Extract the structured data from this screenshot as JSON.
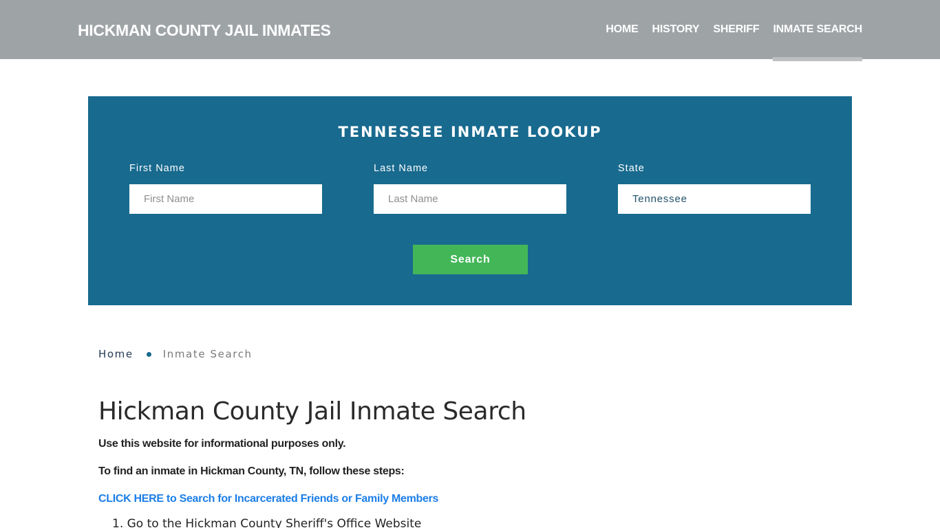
{
  "header": {
    "brand": "HICKMAN COUNTY JAIL INMATES",
    "nav": [
      {
        "label": "HOME",
        "active": false
      },
      {
        "label": "HISTORY",
        "active": false
      },
      {
        "label": "SHERIFF",
        "active": false
      },
      {
        "label": "INMATE SEARCH",
        "active": true
      }
    ]
  },
  "lookup": {
    "title": "TENNESSEE INMATE LOOKUP",
    "first_name": {
      "label": "First Name",
      "placeholder": "First Name",
      "value": ""
    },
    "last_name": {
      "label": "Last Name",
      "placeholder": "Last Name",
      "value": ""
    },
    "state": {
      "label": "State",
      "value": "Tennessee"
    },
    "search_label": "Search"
  },
  "breadcrumb": {
    "home": "Home",
    "current": "Inmate Search"
  },
  "content": {
    "title": "Hickman County Jail Inmate Search",
    "paragraph_1": "Use this website for informational purposes only.",
    "paragraph_2": "To find an inmate in Hickman County, TN, follow these steps:",
    "cta_link": "CLICK HERE to Search for Incarcerated Friends or Family Members",
    "steps": [
      "1. Go to the Hickman County Sheriff's Office Website"
    ]
  },
  "colors": {
    "header_bg": "#9ea3a6",
    "lookup_bg": "#186a8e",
    "search_button": "#43b658",
    "link": "#1b7ee6"
  }
}
